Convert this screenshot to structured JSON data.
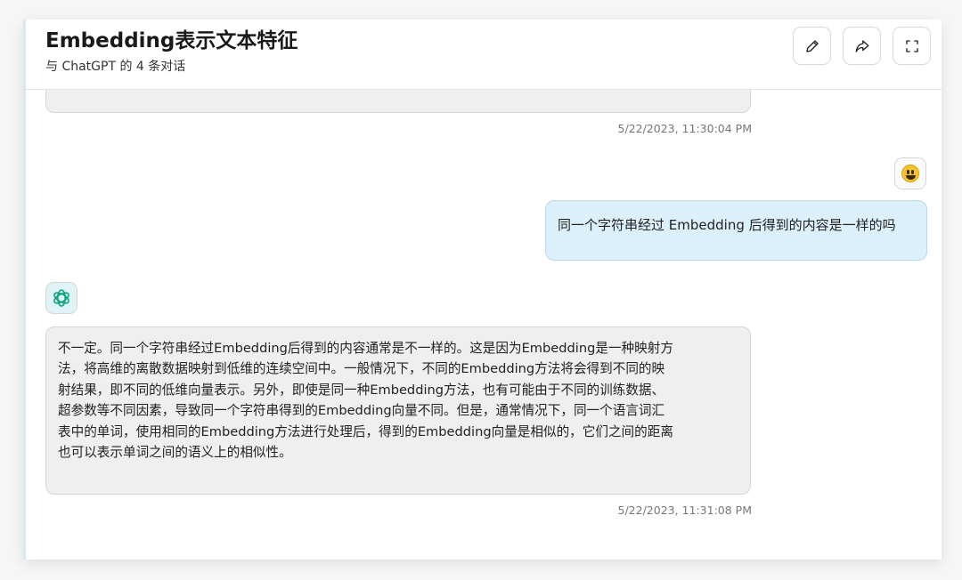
{
  "header": {
    "title": "Embedding表示文本特征",
    "subtitle": "与 ChatGPT 的 4 条对话",
    "buttons": [
      {
        "icon": "pencil-icon"
      },
      {
        "icon": "share-icon"
      },
      {
        "icon": "expand-icon"
      }
    ]
  },
  "messages": [
    {
      "role": "assistant",
      "timestamp": "5/22/2023, 11:30:04 PM"
    },
    {
      "role": "user",
      "avatar": "smiley-emoji-icon",
      "text": "同一个字符串经过 Embedding 后得到的内容是一样的吗"
    },
    {
      "role": "assistant",
      "avatar": "chatgpt-logo-icon",
      "lines": [
        "不一定。同一个字符串经过Embedding后得到的内容通常是不一样的。这是因为Embedding是一种映射方",
        "法，将高维的离散数据映射到低维的连续空间中。一般情况下，不同的Embedding方法将会得到不同的映",
        "射结果，即不同的低维向量表示。另外，即使是同一种Embedding方法，也有可能由于不同的训练数据、",
        "超参数等不同因素，导致同一个字符串得到的Embedding向量不同。但是，通常情况下，同一个语言词汇",
        "表中的单词，使用相同的Embedding方法进行处理后，得到的Embedding向量是相似的，它们之间的距离",
        "也可以表示单词之间的语义上的相似性。"
      ],
      "timestamp": "5/22/2023, 11:31:08 PM"
    }
  ],
  "colors": {
    "user_bubble": "#dcf0fb",
    "assistant_bubble": "#efefef",
    "logo": "#10a37f"
  }
}
